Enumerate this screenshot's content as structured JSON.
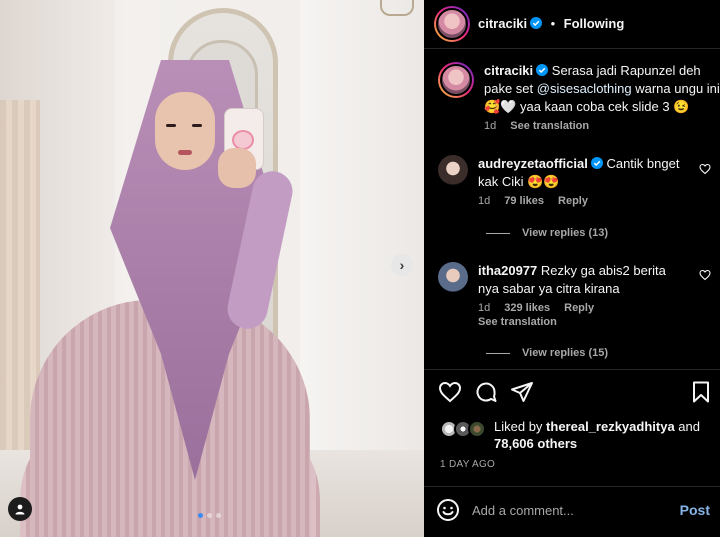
{
  "post": {
    "carousel": {
      "total_slides": 3,
      "current_slide": 1
    }
  },
  "header": {
    "username": "citraciki",
    "separator": "•",
    "follow_status": "Following"
  },
  "caption": {
    "username": "citraciki",
    "text_before": "Serasa jadi Rapunzel deh pake set ",
    "mention": "@sisesaclothing",
    "text_after": " warna ungu ini 🥰🤍 yaa kaan coba cek slide 3 😉",
    "time": "1d",
    "see_translation": "See translation"
  },
  "comments": [
    {
      "username": "audreyzetaofficial",
      "verified": true,
      "text": "Cantik bnget kak Ciki 😍😍",
      "time": "1d",
      "likes": "79 likes",
      "reply": "Reply",
      "view_replies": "View replies (13)"
    },
    {
      "username": "itha20977",
      "verified": false,
      "text": "Rezky ga abis2 berita nya sabar ya citra kirana",
      "time": "1d",
      "likes": "329 likes",
      "reply": "Reply",
      "see_translation": "See translation",
      "view_replies": "View replies (15)"
    }
  ],
  "likes": {
    "prefix": "Liked by ",
    "user": "thereal_rezkyadhitya",
    "middle": " and",
    "others": "78,606 others"
  },
  "timestamp": "1 DAY AGO",
  "add_comment": {
    "placeholder": "Add a comment...",
    "post_label": "Post"
  },
  "colors": {
    "background": "#000000",
    "text_primary": "#f5f5f5",
    "text_secondary": "#a8a8a8",
    "verified_blue": "#0095f6",
    "post_button": "#85b5e8",
    "divider": "#262626",
    "carousel_active_dot": "#3a8cf2"
  },
  "icons": {
    "verified": "verified-badge-icon",
    "like": "heart-icon",
    "comment": "comment-bubble-icon",
    "share": "paper-plane-icon",
    "save": "bookmark-icon",
    "emoji": "smiley-icon",
    "next": "chevron-right-icon",
    "tagged": "user-tag-icon"
  }
}
